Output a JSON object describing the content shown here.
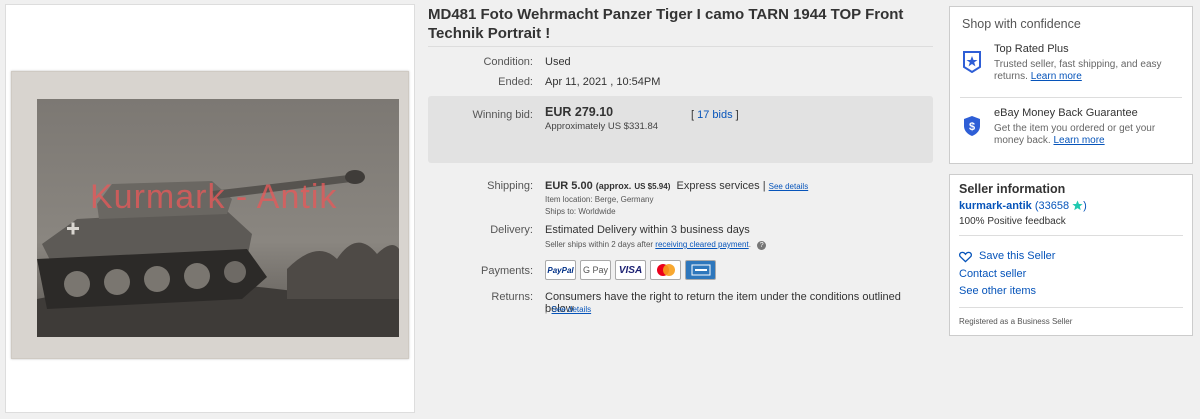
{
  "watermark": "Kurmark - Antik",
  "listing": {
    "title": "MD481 Foto Wehrmacht Panzer Tiger I camo TARN 1944 TOP Front Technik Portrait !",
    "condition_label": "Condition:",
    "condition": "Used",
    "ended_label": "Ended:",
    "ended": "Apr 11, 2021 , 10:54PM",
    "winning_bid_label": "Winning bid:",
    "winning_bid": "EUR 279.10",
    "approx_bid": "Approximately US $331.84",
    "bids_open": "[",
    "bids": "17 bids",
    "bids_close": "]",
    "shipping_label": "Shipping:",
    "shipping_cost": "EUR 5.00",
    "shipping_approx": "(approx.",
    "shipping_approx_usd": "US $5.94)",
    "shipping_service": "Express services",
    "shipping_sep": "|",
    "see_details": "See details",
    "item_location": "Item location:  Berge, Germany",
    "ships_to": "Ships to:  Worldwide",
    "delivery_label": "Delivery:",
    "delivery": "Estimated Delivery within 3 business days",
    "delivery_note": "Seller ships within 2 days after",
    "delivery_link": "receiving cleared payment",
    "delivery_end": ".",
    "payments_label": "Payments:",
    "payment_methods": [
      "PayPal",
      "G Pay",
      "VISA",
      "",
      ""
    ],
    "returns_label": "Returns:",
    "returns": "Consumers have the right to return the item under the conditions outlined below",
    "returns_sep": "|",
    "returns_details": "See details"
  },
  "shop_confidence": {
    "heading": "Shop with confidence",
    "items": [
      {
        "title": "Top Rated Plus",
        "desc": "Trusted seller, fast shipping, and easy returns.",
        "link": "Learn more"
      },
      {
        "title": "eBay Money Back Guarantee",
        "desc": "Get the item you ordered or get your money back.",
        "link": "Learn more"
      }
    ]
  },
  "seller": {
    "heading": "Seller information",
    "name": "kurmark-antik",
    "score": "(33658",
    "score_end": ")",
    "feedback": "100% Positive feedback",
    "save": "Save this Seller",
    "contact": "Contact seller",
    "other_items": "See other items",
    "registered": "Registered as a Business Seller"
  },
  "colors": {
    "link": "#0654ba",
    "badge": "#2e5ed6",
    "star": "#20c9b0"
  }
}
